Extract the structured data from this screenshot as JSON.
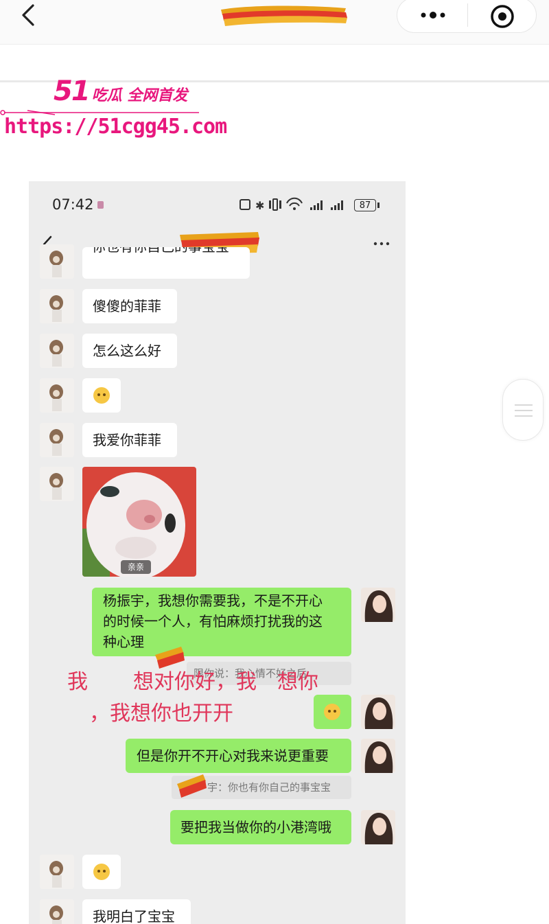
{
  "outer": {
    "watermark_brand": "51",
    "watermark_slogan": "吃瓜 全网首发",
    "watermark_url": "https://51cgg45.com"
  },
  "phone": {
    "status": {
      "time": "07:42",
      "battery": "87"
    },
    "messages": [
      {
        "side": "left",
        "text": "你也有你自己的事宝宝"
      },
      {
        "side": "left",
        "text": "傻傻的菲菲"
      },
      {
        "side": "left",
        "text": "怎么这么好"
      },
      {
        "side": "left",
        "type": "emoji",
        "icon": "sad-face-emoji"
      },
      {
        "side": "left",
        "text": "我爱你菲菲"
      },
      {
        "side": "left",
        "type": "sticker",
        "label": "亲亲"
      },
      {
        "side": "right",
        "lines": [
          "杨振宇，我想你需要我，不是不开心",
          "的时候一个人，有怕麻烦打扰我的这",
          "种心理"
        ]
      },
      {
        "side": "right",
        "type": "quote",
        "text": "限你说：我心情不好之后"
      },
      {
        "side": "right",
        "type": "emoji",
        "icon": "crying-emoji"
      },
      {
        "side": "right",
        "text": "但是你开不开心对我来说更重要"
      },
      {
        "side": "right",
        "type": "quote",
        "text": "宇：你也有你自己的事宝宝"
      },
      {
        "side": "right",
        "text": "要把我当做你的小港湾哦"
      },
      {
        "side": "left",
        "type": "emoji",
        "icon": "sad-face-emoji"
      },
      {
        "side": "left",
        "text": "我明白了宝宝"
      }
    ],
    "overlay": {
      "line1_a": "我",
      "line1_b": "想对你好，我　想你",
      "line2": "，我想你也开开"
    }
  },
  "colors": {
    "green_bubble": "#95ec69",
    "watermark": "#e8177d",
    "overlay": "#e0365a",
    "chat_bg": "#ededed"
  }
}
